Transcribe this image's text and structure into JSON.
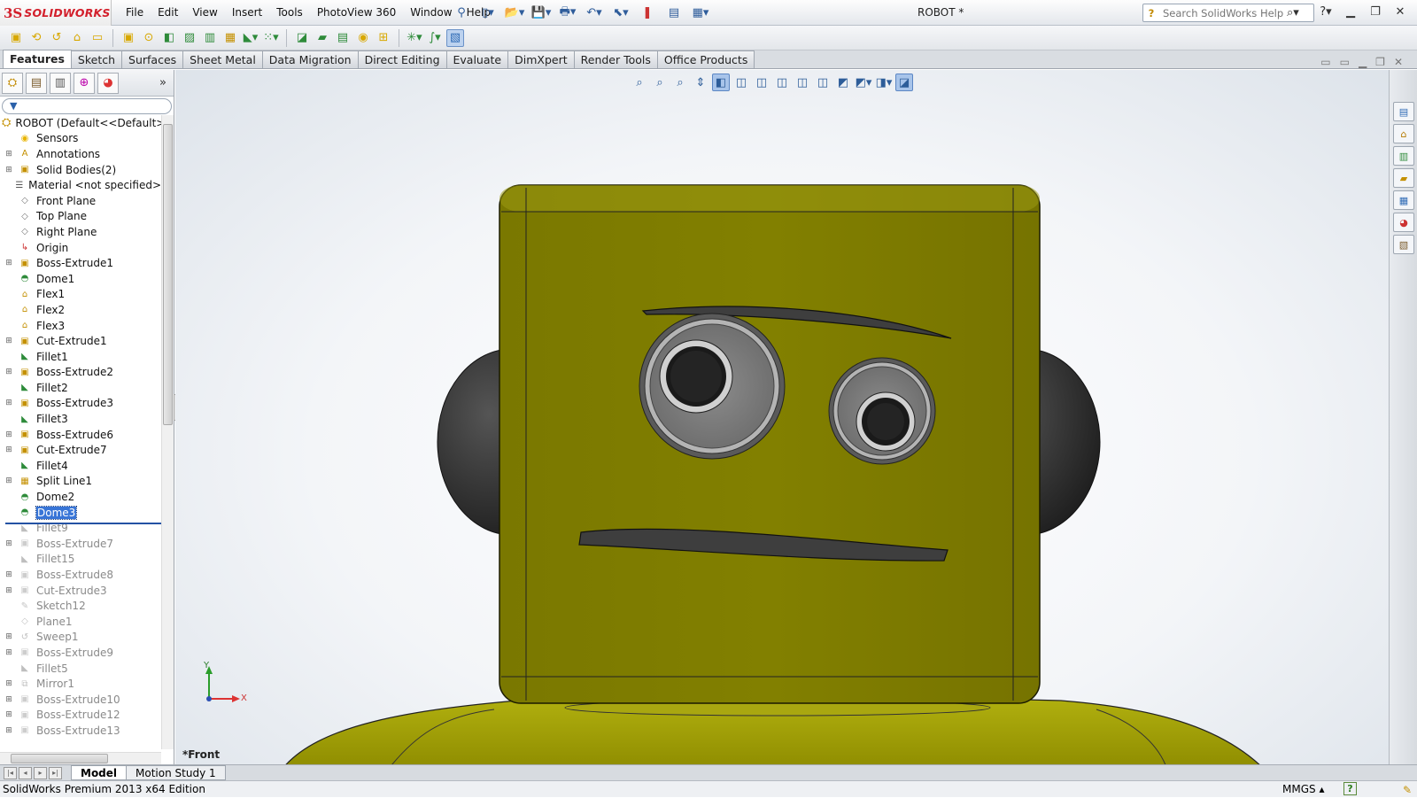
{
  "app": {
    "brand_ds": "3S",
    "brand_name": "SOLIDWORKS",
    "document_title": "ROBOT *"
  },
  "menu": [
    "File",
    "Edit",
    "View",
    "Insert",
    "Tools",
    "PhotoView 360",
    "Window",
    "Help"
  ],
  "search": {
    "placeholder": "Search SolidWorks Help"
  },
  "command_tabs": [
    "Features",
    "Sketch",
    "Surfaces",
    "Sheet Metal",
    "Data Migration",
    "Direct Editing",
    "Evaluate",
    "DimXpert",
    "Render Tools",
    "Office Products"
  ],
  "active_tab": "Features",
  "feature_tree": {
    "root": "ROBOT  (Default<<Default>_D",
    "items": [
      {
        "label": "Sensors",
        "icon": "sensor-icon",
        "expand": false,
        "state": "active"
      },
      {
        "label": "Annotations",
        "icon": "annotation-icon",
        "expand": true,
        "state": "active"
      },
      {
        "label": "Solid Bodies(2)",
        "icon": "solid-bodies-icon",
        "expand": true,
        "state": "active"
      },
      {
        "label": "Material <not specified>",
        "icon": "material-icon",
        "expand": false,
        "state": "active"
      },
      {
        "label": "Front Plane",
        "icon": "plane-icon",
        "expand": false,
        "state": "active"
      },
      {
        "label": "Top Plane",
        "icon": "plane-icon",
        "expand": false,
        "state": "active"
      },
      {
        "label": "Right Plane",
        "icon": "plane-icon",
        "expand": false,
        "state": "active"
      },
      {
        "label": "Origin",
        "icon": "origin-icon",
        "expand": false,
        "state": "active"
      },
      {
        "label": "Boss-Extrude1",
        "icon": "extrude-icon",
        "expand": true,
        "state": "active"
      },
      {
        "label": "Dome1",
        "icon": "dome-icon",
        "expand": false,
        "state": "active"
      },
      {
        "label": "Flex1",
        "icon": "flex-icon",
        "expand": false,
        "state": "active"
      },
      {
        "label": "Flex2",
        "icon": "flex-icon",
        "expand": false,
        "state": "active"
      },
      {
        "label": "Flex3",
        "icon": "flex-icon",
        "expand": false,
        "state": "active"
      },
      {
        "label": "Cut-Extrude1",
        "icon": "cut-icon",
        "expand": true,
        "state": "active"
      },
      {
        "label": "Fillet1",
        "icon": "fillet-icon",
        "expand": false,
        "state": "active"
      },
      {
        "label": "Boss-Extrude2",
        "icon": "extrude-icon",
        "expand": true,
        "state": "active"
      },
      {
        "label": "Fillet2",
        "icon": "fillet-icon",
        "expand": false,
        "state": "active"
      },
      {
        "label": "Boss-Extrude3",
        "icon": "extrude-icon",
        "expand": true,
        "state": "active"
      },
      {
        "label": "Fillet3",
        "icon": "fillet-icon",
        "expand": false,
        "state": "active"
      },
      {
        "label": "Boss-Extrude6",
        "icon": "extrude-icon",
        "expand": true,
        "state": "active"
      },
      {
        "label": "Cut-Extrude7",
        "icon": "cut-icon",
        "expand": true,
        "state": "active"
      },
      {
        "label": "Fillet4",
        "icon": "fillet-icon",
        "expand": false,
        "state": "active"
      },
      {
        "label": "Split Line1",
        "icon": "split-line-icon",
        "expand": true,
        "state": "active"
      },
      {
        "label": "Dome2",
        "icon": "dome-icon",
        "expand": false,
        "state": "active"
      },
      {
        "label": "Dome3",
        "icon": "dome-icon",
        "expand": false,
        "state": "selected"
      },
      {
        "label": "Fillet9",
        "icon": "fillet-icon",
        "expand": false,
        "state": "rolled"
      },
      {
        "label": "Boss-Extrude7",
        "icon": "extrude-icon",
        "expand": true,
        "state": "rolled"
      },
      {
        "label": "Fillet15",
        "icon": "fillet-icon",
        "expand": false,
        "state": "rolled"
      },
      {
        "label": "Boss-Extrude8",
        "icon": "extrude-icon",
        "expand": true,
        "state": "rolled"
      },
      {
        "label": "Cut-Extrude3",
        "icon": "cut-icon",
        "expand": true,
        "state": "rolled"
      },
      {
        "label": "Sketch12",
        "icon": "sketch-icon",
        "expand": false,
        "state": "rolled"
      },
      {
        "label": "Plane1",
        "icon": "plane-icon",
        "expand": false,
        "state": "rolled"
      },
      {
        "label": "Sweep1",
        "icon": "sweep-icon",
        "expand": true,
        "state": "rolled"
      },
      {
        "label": "Boss-Extrude9",
        "icon": "extrude-icon",
        "expand": true,
        "state": "rolled"
      },
      {
        "label": "Fillet5",
        "icon": "fillet-icon",
        "expand": false,
        "state": "rolled"
      },
      {
        "label": "Mirror1",
        "icon": "mirror-icon",
        "expand": true,
        "state": "rolled"
      },
      {
        "label": "Boss-Extrude10",
        "icon": "extrude-icon",
        "expand": true,
        "state": "rolled"
      },
      {
        "label": "Boss-Extrude12",
        "icon": "extrude-icon",
        "expand": true,
        "state": "rolled"
      },
      {
        "label": "Boss-Extrude13",
        "icon": "extrude-icon",
        "expand": true,
        "state": "rolled"
      }
    ]
  },
  "viewport": {
    "view_label": "*Front",
    "triad_x": "X",
    "triad_y": "Y"
  },
  "bottom_tabs": [
    "Model",
    "Motion Study 1"
  ],
  "active_bottom_tab": "Model",
  "status": {
    "edition": "SolidWorks Premium 2013 x64 Edition",
    "units": "MMGS"
  },
  "colors": {
    "model_body": "#7d7b00",
    "model_highlight": "#9a9a10",
    "ear": "#2e2e2e",
    "selection": "#3875d7",
    "brand_red": "#d3202c"
  }
}
